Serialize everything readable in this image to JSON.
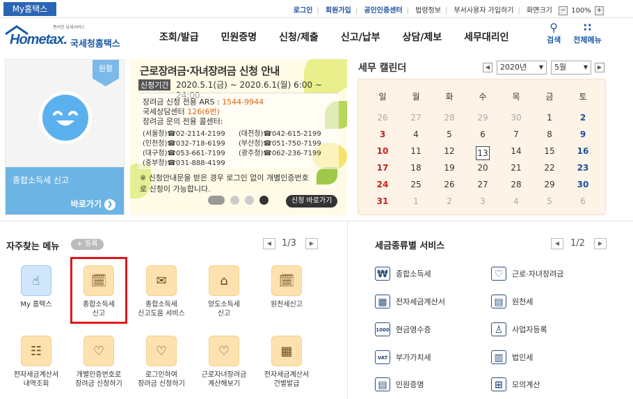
{
  "topbar": {
    "my_home": "My홈택스",
    "links": [
      "로그인",
      "회원가입",
      "공인인증센터",
      "법령정보",
      "부서사용자 가입하기",
      "화면크기"
    ],
    "zoom": "100%",
    "zoom_out": "−",
    "zoom_in": "+"
  },
  "header": {
    "logo_small": "편리한 납세서비스",
    "logo_text": "Hometax.",
    "logo_kr": "국세청홈택스",
    "nav": [
      "조회/발급",
      "민원증명",
      "신청/제출",
      "신고/납부",
      "상담/제보",
      "세무대리인"
    ],
    "search_label": "검색",
    "allmenu_label": "전체메뉴"
  },
  "left_box": {
    "badge": "원활",
    "title": "종합소득세 신고",
    "link": "바로가기"
  },
  "banner": {
    "title": "근로장려금·자녀장려금 신청 안내",
    "period_label": "신청기간",
    "period": "2020.5.1(금) ~ 2020.6.1(월) 6:00 ~ 24:00",
    "ars_label": "장려금 신청 전용 ARS :",
    "ars_num": "1544-9944",
    "center_label": "국세상담센터",
    "center_num": "126(6번)",
    "call_title": "장려금 문의 전용 콜센터:",
    "calls": [
      {
        "region": "(서울청)",
        "num": "☎02-2114-2199"
      },
      {
        "region": "(대전청)",
        "num": "☎042-615-2199"
      },
      {
        "region": "(인천청)",
        "num": "☎032-718-6199"
      },
      {
        "region": "(부산청)",
        "num": "☎051-750-7199"
      },
      {
        "region": "(대구청)",
        "num": "☎053-661-7199"
      },
      {
        "region": "(광주청)",
        "num": "☎062-236-7199"
      },
      {
        "region": "(중부청)",
        "num": "☎031-888-4199"
      }
    ],
    "note": "※ 신청안내문을 받은 경우 로그인 없이 개별인증번호로 신청이 가능합니다.",
    "apply_button": "신청 바로가기"
  },
  "calendar": {
    "title": "세무 캘린더",
    "year": "2020년",
    "month": "5월",
    "weekdays": [
      "일",
      "월",
      "화",
      "수",
      "목",
      "금",
      "토"
    ],
    "weeks": [
      [
        "26",
        "27",
        "28",
        "29",
        "30",
        "1",
        "2"
      ],
      [
        "3",
        "4",
        "5",
        "6",
        "7",
        "8",
        "9"
      ],
      [
        "10",
        "11",
        "12",
        "13",
        "14",
        "15",
        "16"
      ],
      [
        "17",
        "18",
        "19",
        "20",
        "21",
        "22",
        "23"
      ],
      [
        "24",
        "25",
        "26",
        "27",
        "28",
        "29",
        "30"
      ],
      [
        "31",
        "1",
        "2",
        "3",
        "4",
        "5",
        "6"
      ]
    ],
    "today": "13"
  },
  "favorites": {
    "title": "자주찾는 메뉴",
    "register": "+ 등록",
    "page": "1/3",
    "items": [
      {
        "l1": "My 홈택스",
        "l2": ""
      },
      {
        "l1": "종합소득세",
        "l2": "신고"
      },
      {
        "l1": "종합소득세",
        "l2": "신고도움 서비스"
      },
      {
        "l1": "양도소득세",
        "l2": "신고"
      },
      {
        "l1": "원천세신고",
        "l2": ""
      },
      {
        "l1": "전자세금계산서",
        "l2": "내역조회"
      },
      {
        "l1": "개별인증번호로",
        "l2": "장려금 신청하기"
      },
      {
        "l1": "로그인하여",
        "l2": "장려금 신청하기"
      },
      {
        "l1": "근로자녀장려금",
        "l2": "계산해보기"
      },
      {
        "l1": "전자세금계산서",
        "l2": "건별발급"
      }
    ]
  },
  "tax_services": {
    "title": "세금종류별 서비스",
    "page": "1/2",
    "items": [
      "종합소득세",
      "근로·자녀장려금",
      "전자세금계산서",
      "원천세",
      "현금영수증",
      "사업자등록",
      "부가가치세",
      "법인세",
      "민원증명",
      "모의계산"
    ],
    "glyphs": [
      "₩",
      "♡",
      "▦",
      "▤",
      "1000",
      "♙",
      "VAT",
      "▥",
      "▤",
      "⊞"
    ]
  }
}
